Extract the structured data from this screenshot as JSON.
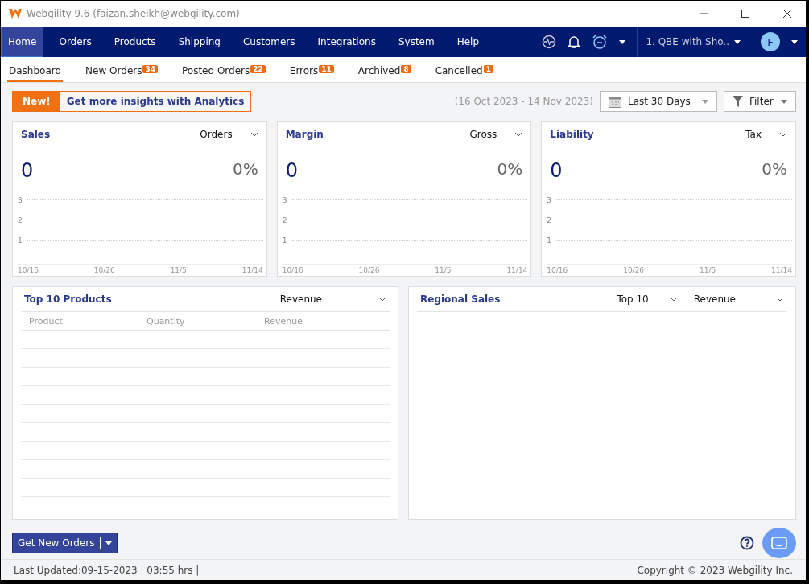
{
  "window": {
    "title": "Webgility 9.6 (faizan.sheikh@webgility.com)"
  },
  "menu": [
    {
      "label": "Home",
      "selected": true
    },
    {
      "label": "Orders",
      "selected": false
    },
    {
      "label": "Products",
      "selected": false
    },
    {
      "label": "Shipping",
      "selected": false
    },
    {
      "label": "Customers",
      "selected": false
    },
    {
      "label": "Integrations",
      "selected": false
    },
    {
      "label": "System",
      "selected": false
    },
    {
      "label": "Help",
      "selected": false
    }
  ],
  "account": {
    "store": "1. QBE with Sho..",
    "avatar": "F"
  },
  "tabs": [
    {
      "label": "Dashboard",
      "selected": true
    },
    {
      "label": "New Orders",
      "count": "34",
      "selected": false
    },
    {
      "label": "Posted Orders",
      "count": "22",
      "selected": false
    },
    {
      "label": "Errors",
      "count": "11",
      "selected": false
    },
    {
      "label": "Archived",
      "count": "8",
      "selected": false
    },
    {
      "label": "Cancelled",
      "count": "1",
      "selected": false
    }
  ],
  "promo": {
    "badge": "New!",
    "text": "Get more insights with Analytics"
  },
  "date_range": "(16 Oct 2023 - 14 Nov 2023)",
  "period": "Last 30 Days",
  "filter": "Filter",
  "cards": [
    {
      "title": "Sales",
      "option": "Orders",
      "value": "0",
      "percent": "0%",
      "y_labels": [
        "3",
        "2",
        "1"
      ],
      "x_labels": [
        "10/16",
        "10/26",
        "11/5",
        "11/14"
      ]
    },
    {
      "title": "Margin",
      "option": "Gross",
      "value": "0",
      "percent": "0%",
      "y_labels": [
        "3",
        "2",
        "1"
      ],
      "x_labels": [
        "10/16",
        "10/26",
        "11/5",
        "11/14"
      ]
    },
    {
      "title": "Liability",
      "option": "Tax",
      "value": "0",
      "percent": "0%",
      "y_labels": [
        "3",
        "2",
        "1"
      ],
      "x_labels": [
        "10/16",
        "10/26",
        "11/5",
        "11/14"
      ]
    }
  ],
  "top_products": {
    "title": "Top 10 Products",
    "option": "Revenue",
    "columns": [
      "Product",
      "Quantity",
      "Revenue"
    ]
  },
  "regional_sales": {
    "title": "Regional Sales",
    "options": [
      "Top 10",
      "Revenue"
    ]
  },
  "get_orders_button": "Get New Orders",
  "status_bar": {
    "left": "Last Updated:09-15-2023 | 03:55 hrs |",
    "right": "Copyright © 2023 Webgility Inc."
  }
}
